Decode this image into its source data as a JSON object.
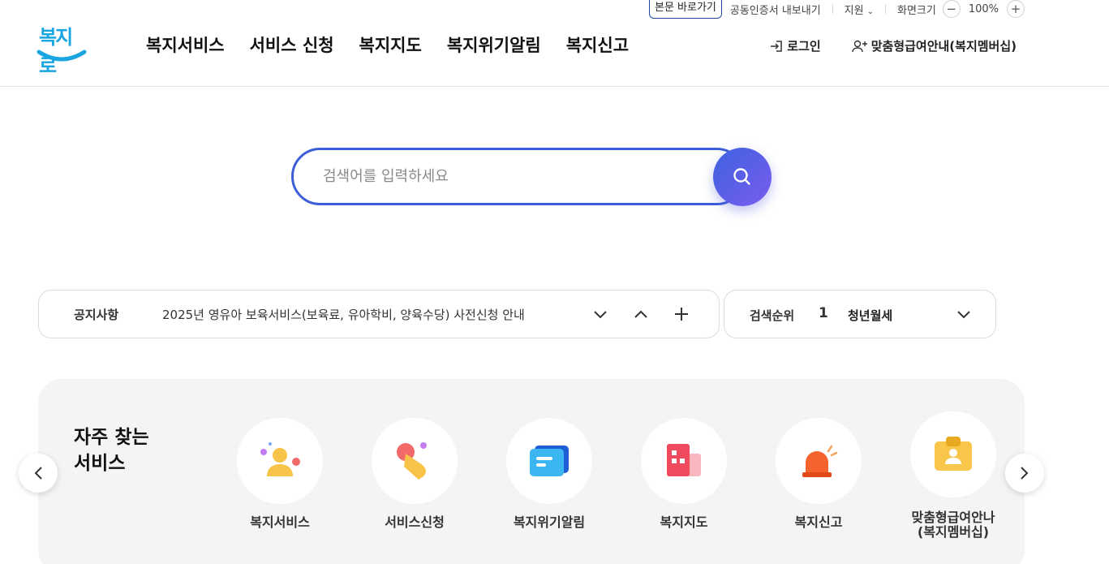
{
  "util": {
    "skip": "본문 바로가기",
    "cert": "공동인증서 내보내기",
    "support": "지원",
    "screen_size": "화면크기",
    "zoom_out": "−",
    "zoom": "100%",
    "zoom_in": "+"
  },
  "header": {
    "logo": "복지로",
    "nav": [
      "복지서비스",
      "서비스 신청",
      "복지지도",
      "복지위기알림",
      "복지신고"
    ],
    "login": "로그인",
    "membership": "맞춤형급여안내(복지멤버십)"
  },
  "search": {
    "placeholder": "검색어를 입력하세요"
  },
  "notice": {
    "label": "공지사항",
    "text": "2025년 영유아 보육서비스(보육료, 유아학비, 양육수당) 사전신청 안내"
  },
  "rank": {
    "label": "검색순위",
    "number": "1",
    "keyword": "청년월세"
  },
  "frequent": {
    "title": "자주 찾는 서비스",
    "items": [
      {
        "label": "복지서비스",
        "icon": "person-icon"
      },
      {
        "label": "서비스신청",
        "icon": "hand-tap-icon"
      },
      {
        "label": "복지위기알림",
        "icon": "message-icon"
      },
      {
        "label": "복지지도",
        "icon": "building-icon"
      },
      {
        "label": "복지신고",
        "icon": "siren-icon"
      },
      {
        "label": "맞춤형급여안나\n(복지멤버십)",
        "icon": "id-badge-icon"
      }
    ]
  }
}
